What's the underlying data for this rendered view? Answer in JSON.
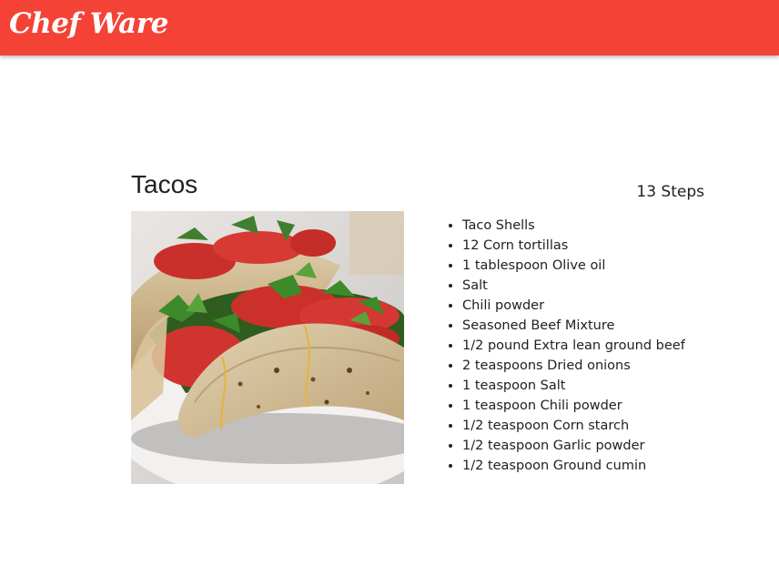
{
  "header": {
    "brand": "Chef Ware",
    "color": "#f44336"
  },
  "recipe": {
    "title": "Tacos",
    "steps_label": "13 Steps",
    "ingredients": [
      "Taco Shells",
      "12 Corn tortillas",
      "1 tablespoon Olive oil",
      "Salt",
      "Chili powder",
      "Seasoned Beef Mixture",
      "1/2 pound Extra lean ground beef",
      "2 teaspoons Dried onions",
      "1 teaspoon Salt",
      "1 teaspoon Chili powder",
      "1/2 teaspoon Corn starch",
      "1/2 teaspoon Garlic powder",
      "1/2 teaspoon Ground cumin"
    ]
  }
}
